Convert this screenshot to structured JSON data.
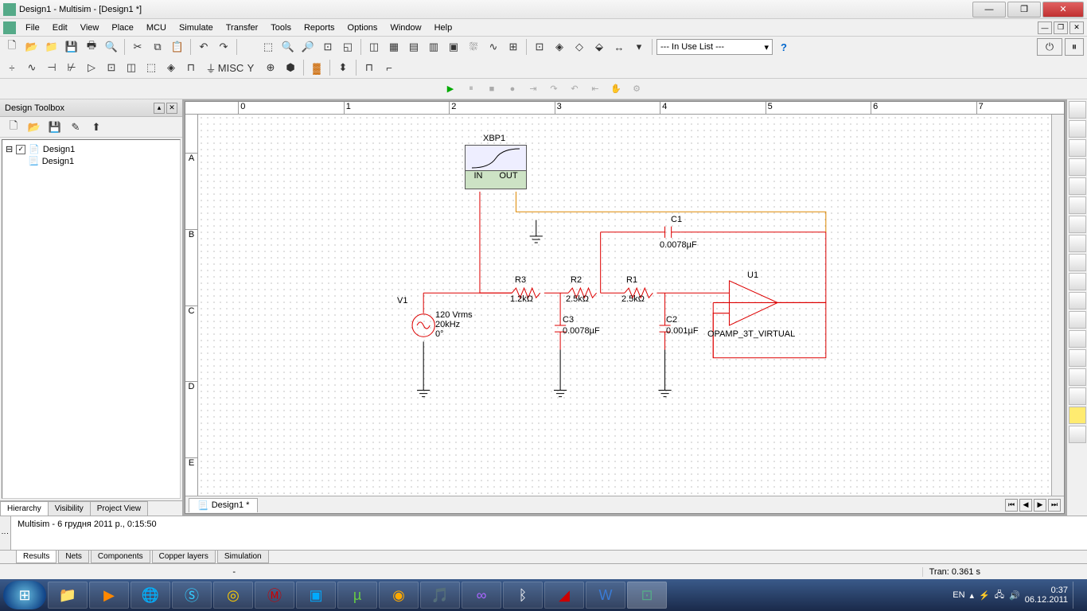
{
  "window": {
    "title": "Design1 - Multisim - [Design1 *]"
  },
  "menu": [
    "File",
    "Edit",
    "View",
    "Place",
    "MCU",
    "Simulate",
    "Transfer",
    "Tools",
    "Reports",
    "Options",
    "Window",
    "Help"
  ],
  "toolbar1_combo": "--- In Use List ---",
  "sidebar": {
    "title": "Design Toolbox",
    "tree_root": "Design1",
    "tree_child": "Design1",
    "tabs": [
      "Hierarchy",
      "Visibility",
      "Project View"
    ]
  },
  "canvas": {
    "tab": "Design1 *",
    "ruler_h": [
      "0",
      "1",
      "2",
      "3",
      "4",
      "5",
      "6",
      "7"
    ],
    "ruler_v": [
      "A",
      "B",
      "C",
      "D",
      "E"
    ]
  },
  "circuit": {
    "xbp1": "XBP1",
    "xbp1_in": "IN",
    "xbp1_out": "OUT",
    "v1": "V1",
    "v1_l1": "120 Vrms",
    "v1_l2": "20kHz",
    "v1_l3": "0°",
    "r3": "R3",
    "r3v": "1.2kΩ",
    "r2": "R2",
    "r2v": "2.5kΩ",
    "r1": "R1",
    "r1v": "2.5kΩ",
    "c1": "C1",
    "c1v": "0.0078µF",
    "c2": "C2",
    "c2v": "0.001µF",
    "c3": "C3",
    "c3v": "0.0078µF",
    "u1": "U1",
    "u1v": "OPAMP_3T_VIRTUAL"
  },
  "bottom": {
    "msg": "Multisim  -  6 грудня 2011 р., 0:15:50",
    "tabs": [
      "Results",
      "Nets",
      "Components",
      "Copper layers",
      "Simulation"
    ]
  },
  "status": {
    "tran": "Tran: 0.361 s"
  },
  "taskbar": {
    "lang": "EN",
    "time": "0:37",
    "date": "06.12.2011"
  }
}
